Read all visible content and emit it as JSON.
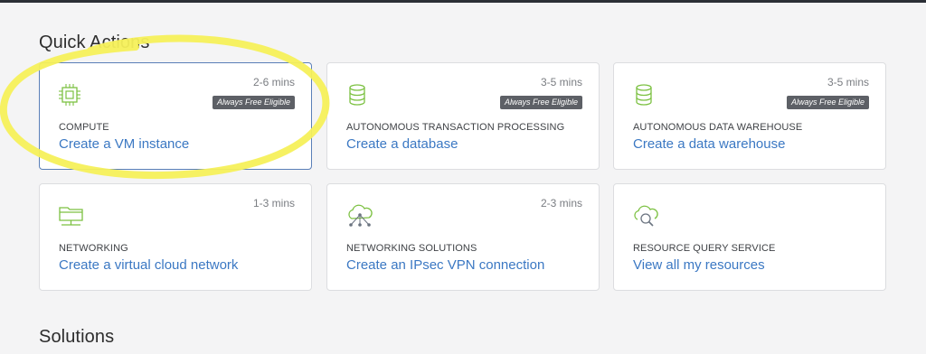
{
  "sections": {
    "quick_actions_title": "Quick Actions",
    "solutions_title": "Solutions"
  },
  "cards": [
    {
      "time": "2-6 mins",
      "badge": "Always Free Eligible",
      "category": "COMPUTE",
      "action": "Create a VM instance",
      "icon": "chip-icon"
    },
    {
      "time": "3-5 mins",
      "badge": "Always Free Eligible",
      "category": "AUTONOMOUS TRANSACTION PROCESSING",
      "action": "Create a database",
      "icon": "database-icon"
    },
    {
      "time": "3-5 mins",
      "badge": "Always Free Eligible",
      "category": "AUTONOMOUS DATA WAREHOUSE",
      "action": "Create a data warehouse",
      "icon": "database-icon"
    },
    {
      "time": "1-3 mins",
      "category": "NETWORKING",
      "action": "Create a virtual cloud network",
      "icon": "network-folder-icon"
    },
    {
      "time": "2-3 mins",
      "category": "NETWORKING SOLUTIONS",
      "action": "Create an IPsec VPN connection",
      "icon": "cloud-network-icon"
    },
    {
      "category": "RESOURCE QUERY SERVICE",
      "action": "View all my resources",
      "icon": "cloud-search-icon"
    }
  ],
  "colors": {
    "accent_link": "#3b78c3",
    "icon_green": "#7cc142",
    "highlight_yellow": "#f6f05a"
  }
}
